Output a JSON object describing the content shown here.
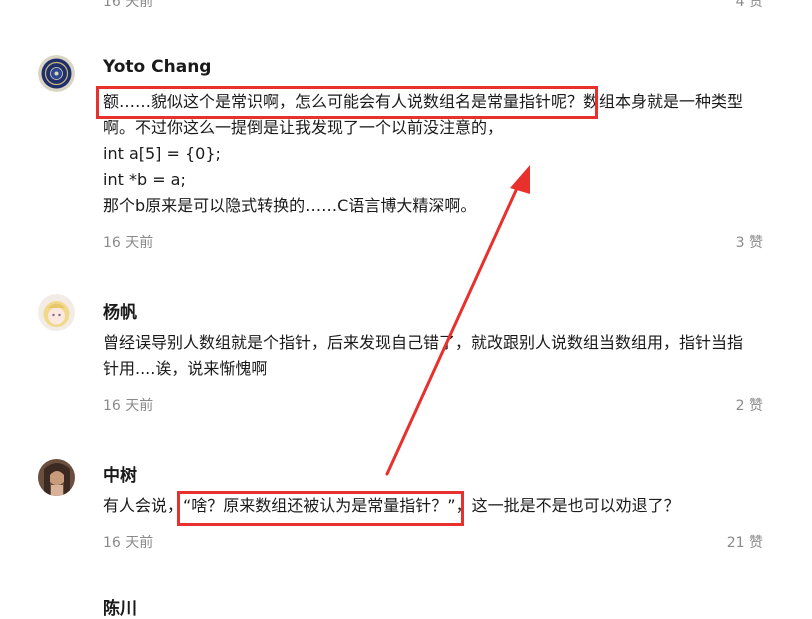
{
  "top_meta": {
    "time": "16 天前",
    "likes": "4 赞"
  },
  "comments": [
    {
      "author": "Yoto Chang",
      "lines": [
        "额……貌似这个是常识啊，怎么可能会有人说数组名是常量指针呢？数组本身就是一种类型",
        "啊。不过你这么一提倒是让我发现了一个以前没注意的，",
        "int a[5] = {0};",
        "int *b = a;",
        "那个b原来是可以隐式转换的……C语言博大精深啊。"
      ],
      "time": "16 天前",
      "likes": "3 赞"
    },
    {
      "author": "杨帆",
      "lines": [
        "曾经误导别人数组就是个指针，后来发现自己错了，就改跟别人说数组当数组用，指针当指",
        "针用....诶，说来惭愧啊"
      ],
      "time": "16 天前",
      "likes": "2 赞"
    },
    {
      "author": "中树",
      "lines": [
        "有人会说，“啥？原来数组还被认为是常量指针？”，这一批是不是也可以劝退了？"
      ],
      "time": "16 天前",
      "likes": "21 赞"
    },
    {
      "author": "陈川"
    }
  ],
  "annotation_color": "#e8302c"
}
